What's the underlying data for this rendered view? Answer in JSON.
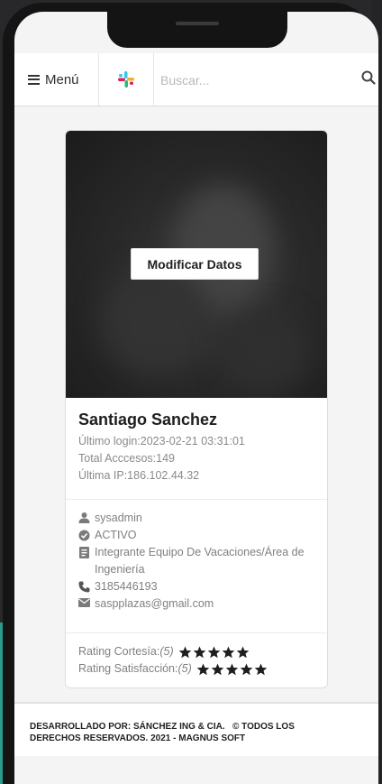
{
  "header": {
    "menu_label": "Menú",
    "search_placeholder": "Buscar...",
    "logo_icon": "slack-logo-icon",
    "search_icon": "search-icon"
  },
  "profile": {
    "modify_button": "Modificar Datos",
    "name": "Santiago Sanchez",
    "last_login": "Último login:2023-02-21 03:31:01",
    "total_access": "Total Acccesos:149",
    "last_ip": "Última IP:186.102.44.32"
  },
  "details": {
    "username": "sysadmin",
    "status": "ACTIVO",
    "role": "Integrante Equipo De Vacaciones/Área de Ingeniería",
    "phone": "3185446193",
    "email": "saspplazas@gmail.com"
  },
  "ratings": [
    {
      "label": "Rating Cortesía:",
      "value_text": "(5)",
      "stars": 5
    },
    {
      "label": "Rating Satisfacción:",
      "value_text": "(5)",
      "stars": 5
    }
  ],
  "footer": {
    "line1": "DESARROLLADO POR: SÁNCHEZ ING & CIA.   © TODOS LOS",
    "line2": "DERECHOS RESERVADOS. 2021 - MAGNUS SOFT"
  },
  "colors": {
    "frame": "#141414",
    "screen_bg": "#f4f4f4",
    "teal_accent": "#2b9c8c",
    "text_dark": "#1e1e1e",
    "text_muted": "#808080"
  }
}
